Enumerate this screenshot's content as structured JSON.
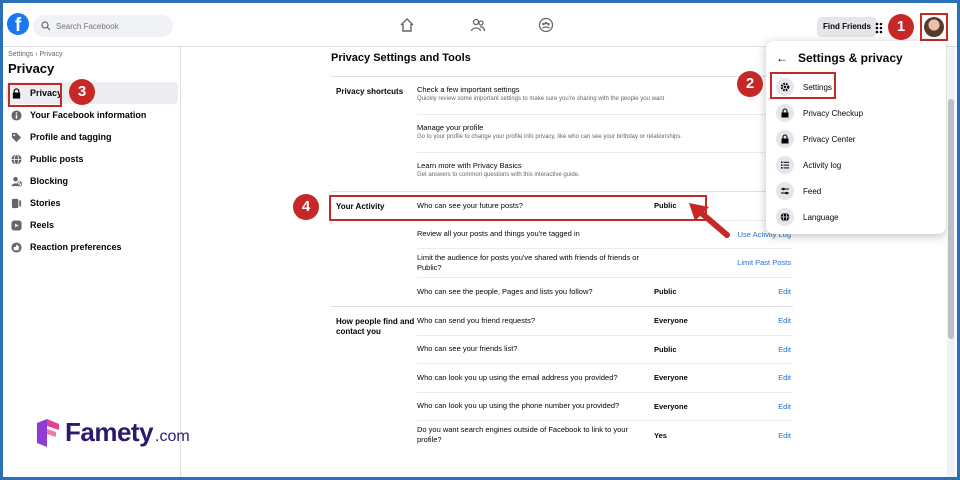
{
  "topbar": {
    "logo": "f",
    "search_placeholder": "Search Facebook",
    "find_friends_label": "Find Friends"
  },
  "sidebar": {
    "breadcrumb": "Settings › Privacy",
    "title": "Privacy",
    "items": [
      {
        "label": "Privacy",
        "icon": "lock-icon"
      },
      {
        "label": "Your Facebook information",
        "icon": "facebook-info-icon"
      },
      {
        "label": "Profile and tagging",
        "icon": "tag-icon"
      },
      {
        "label": "Public posts",
        "icon": "globe-icon"
      },
      {
        "label": "Blocking",
        "icon": "block-user-icon"
      },
      {
        "label": "Stories",
        "icon": "stories-icon"
      },
      {
        "label": "Reels",
        "icon": "reels-icon"
      },
      {
        "label": "Reaction preferences",
        "icon": "reaction-icon"
      }
    ]
  },
  "main": {
    "title": "Privacy Settings and Tools",
    "shortcuts": {
      "label": "Privacy shortcuts",
      "rows": [
        {
          "title": "Check a few important settings",
          "sub": "Quickly review some important settings to make sure you're sharing with the people you want"
        },
        {
          "title": "Manage your profile",
          "sub": "Go to your profile to change your profile info privacy, like who can see your birthday or relationships."
        },
        {
          "title": "Learn more with Privacy Basics",
          "sub": "Get answers to common questions with this interactive guide."
        }
      ]
    },
    "activity": {
      "label": "Your Activity",
      "rows": [
        {
          "q": "Who can see your future posts?",
          "v": "Public",
          "a": ""
        },
        {
          "q": "Review all your posts and things you're tagged in",
          "v": "",
          "a": "Use Activity Log"
        },
        {
          "q": "Limit the audience for posts you've shared with friends of friends or Public?",
          "v": "",
          "a": "Limit Past Posts"
        },
        {
          "q": "Who can see the people, Pages and lists you follow?",
          "v": "Public",
          "a": "Edit"
        }
      ]
    },
    "find": {
      "label": "How people find and contact you",
      "rows": [
        {
          "q": "Who can send you friend requests?",
          "v": "Everyone",
          "a": "Edit"
        },
        {
          "q": "Who can see your friends list?",
          "v": "Public",
          "a": "Edit"
        },
        {
          "q": "Who can look you up using the email address you provided?",
          "v": "Everyone",
          "a": "Edit"
        },
        {
          "q": "Who can look you up using the phone number you provided?",
          "v": "Everyone",
          "a": "Edit"
        },
        {
          "q": "Do you want search engines outside of Facebook to link to your profile?",
          "v": "Yes",
          "a": "Edit"
        }
      ]
    }
  },
  "dropdown": {
    "title": "Settings & privacy",
    "items": [
      {
        "label": "Settings",
        "icon": "gear-icon"
      },
      {
        "label": "Privacy Checkup",
        "icon": "lock-check-icon"
      },
      {
        "label": "Privacy Center",
        "icon": "lock-icon"
      },
      {
        "label": "Activity log",
        "icon": "list-icon"
      },
      {
        "label": "Feed",
        "icon": "sliders-icon"
      },
      {
        "label": "Language",
        "icon": "globe-icon"
      }
    ]
  },
  "badges": {
    "one": "1",
    "two": "2",
    "three": "3",
    "four": "4"
  },
  "brand": {
    "name": "Famety",
    "suffix": ".com"
  },
  "colors": {
    "facebook_blue": "#1877f2",
    "annotation_red": "#c62828",
    "link_blue": "#216fdb",
    "brand_purple": "#2d1a6e"
  }
}
